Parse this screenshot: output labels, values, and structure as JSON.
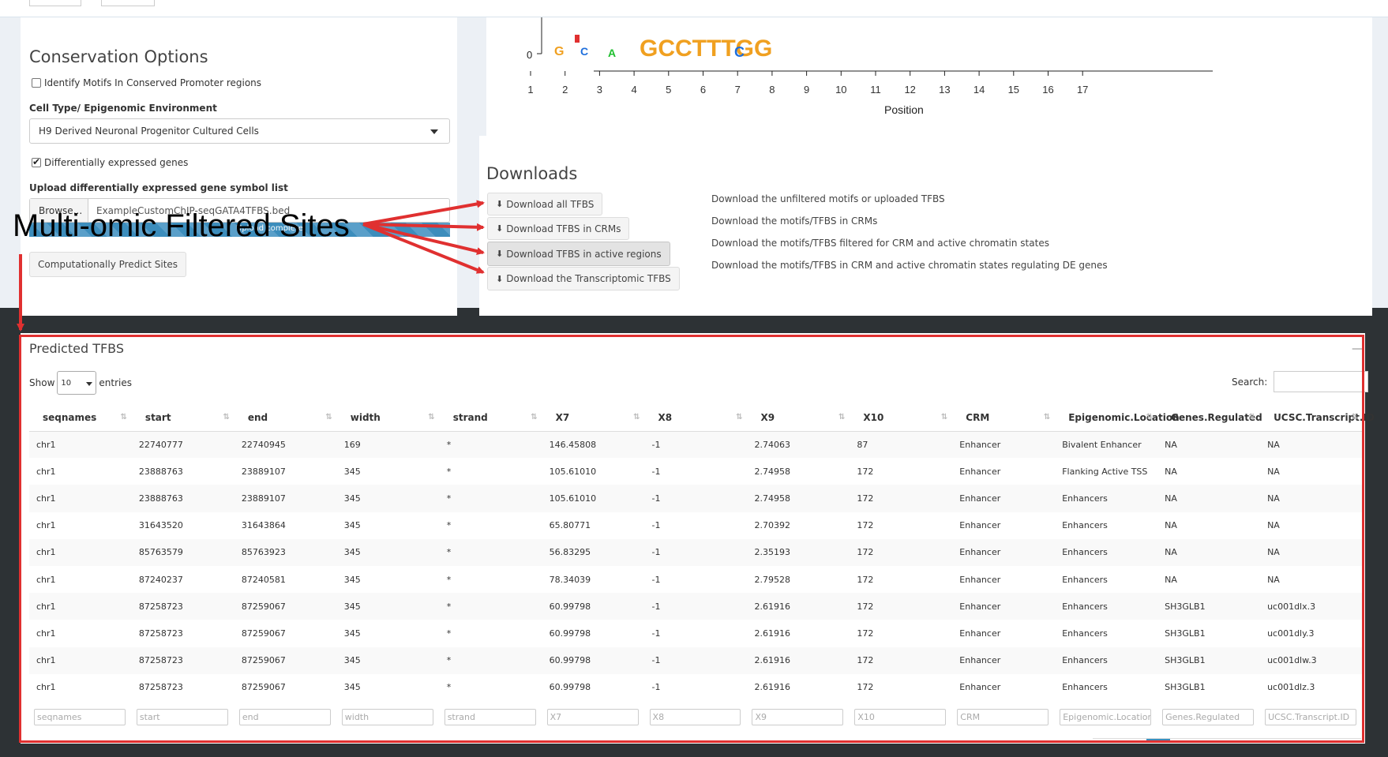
{
  "conservation": {
    "title": "Conservation Options",
    "conserved_label": "Identify Motifs In Conserved Promoter regions",
    "conserved_checked": false,
    "cell_type_label": "Cell Type/ Epigenomic Environment",
    "cell_type_value": "H9 Derived Neuronal Progenitor Cultured Cells",
    "de_label": "Differentially expressed genes",
    "de_checked": true,
    "upload_label": "Upload differentially expressed gene symbol list",
    "browse_label": "Browse...",
    "file_name": "ExampleCustomChIP-seqGATA4TFBS.bed",
    "upload_status": "Upload complete",
    "predict_button": "Computationally Predict Sites"
  },
  "annotation": {
    "label": "Multi-omic Filtered Sites",
    "color": "#e03030"
  },
  "logo": {
    "y_tick": "0",
    "positions": [
      "1",
      "2",
      "3",
      "4",
      "5",
      "6",
      "7",
      "8",
      "9",
      "10",
      "11",
      "12",
      "13",
      "14",
      "15",
      "16",
      "17"
    ],
    "xlabel": "Position",
    "consensus": "GCCTTTGG"
  },
  "downloads": {
    "title": "Downloads",
    "buttons": [
      {
        "label": "Download all TFBS",
        "description": "Download the unfiltered motifs or uploaded TFBS"
      },
      {
        "label": "Download TFBS in CRMs",
        "description": "Download the motifs/TFBS in CRMs"
      },
      {
        "label": "Download TFBS in active regions",
        "description": "Download the motifs/TFBS filtered for CRM and active chromatin states"
      },
      {
        "label": "Download the Transcriptomic TFBS",
        "description": "Download the motifs/TFBS in CRM and active chromatin states regulating DE genes"
      }
    ]
  },
  "table": {
    "title": "Predicted TFBS",
    "show_label": "Show",
    "page_length": "10",
    "entries_label": "entries",
    "search_label": "Search:",
    "columns": [
      "seqnames",
      "start",
      "end",
      "width",
      "strand",
      "X7",
      "X8",
      "X9",
      "X10",
      "CRM",
      "Epigenomic.Location",
      "Genes.Regulated",
      "UCSC.Transcript.ID"
    ],
    "rows": [
      [
        "chr1",
        "22740777",
        "22740945",
        "169",
        "*",
        "146.45808",
        "-1",
        "2.74063",
        "87",
        "Enhancer",
        "Bivalent Enhancer",
        "NA",
        "NA"
      ],
      [
        "chr1",
        "23888763",
        "23889107",
        "345",
        "*",
        "105.61010",
        "-1",
        "2.74958",
        "172",
        "Enhancer",
        "Flanking Active TSS",
        "NA",
        "NA"
      ],
      [
        "chr1",
        "23888763",
        "23889107",
        "345",
        "*",
        "105.61010",
        "-1",
        "2.74958",
        "172",
        "Enhancer",
        "Enhancers",
        "NA",
        "NA"
      ],
      [
        "chr1",
        "31643520",
        "31643864",
        "345",
        "*",
        "65.80771",
        "-1",
        "2.70392",
        "172",
        "Enhancer",
        "Enhancers",
        "NA",
        "NA"
      ],
      [
        "chr1",
        "85763579",
        "85763923",
        "345",
        "*",
        "56.83295",
        "-1",
        "2.35193",
        "172",
        "Enhancer",
        "Enhancers",
        "NA",
        "NA"
      ],
      [
        "chr1",
        "87240237",
        "87240581",
        "345",
        "*",
        "78.34039",
        "-1",
        "2.79528",
        "172",
        "Enhancer",
        "Enhancers",
        "NA",
        "NA"
      ],
      [
        "chr1",
        "87258723",
        "87259067",
        "345",
        "*",
        "60.99798",
        "-1",
        "2.61916",
        "172",
        "Enhancer",
        "Enhancers",
        "SH3GLB1",
        "uc001dlx.3"
      ],
      [
        "chr1",
        "87258723",
        "87259067",
        "345",
        "*",
        "60.99798",
        "-1",
        "2.61916",
        "172",
        "Enhancer",
        "Enhancers",
        "SH3GLB1",
        "uc001dly.3"
      ],
      [
        "chr1",
        "87258723",
        "87259067",
        "345",
        "*",
        "60.99798",
        "-1",
        "2.61916",
        "172",
        "Enhancer",
        "Enhancers",
        "SH3GLB1",
        "uc001dlw.3"
      ],
      [
        "chr1",
        "87258723",
        "87259067",
        "345",
        "*",
        "60.99798",
        "-1",
        "2.61916",
        "172",
        "Enhancer",
        "Enhancers",
        "SH3GLB1",
        "uc001dlz.3"
      ]
    ]
  }
}
